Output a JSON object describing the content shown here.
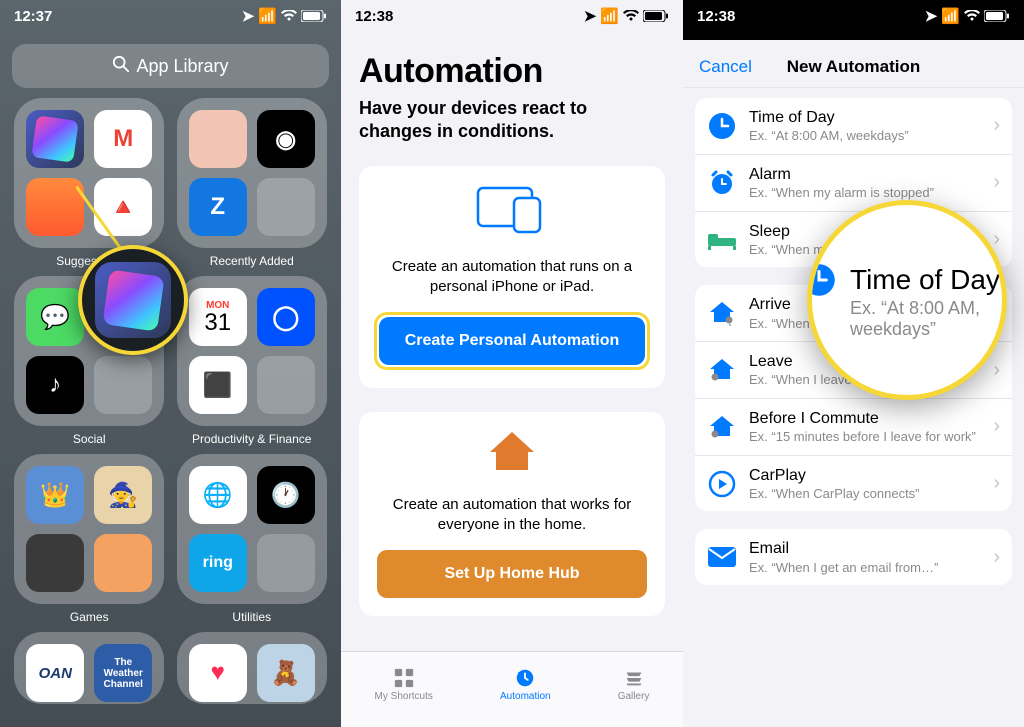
{
  "status": {
    "time_1": "12:37",
    "time_2": "12:38",
    "time_3": "12:38"
  },
  "panel1": {
    "search_label": "App Library",
    "folders": [
      {
        "name": "Suggestions"
      },
      {
        "name": "Recently Added"
      },
      {
        "name": "Social"
      },
      {
        "name": "Productivity & Finance"
      },
      {
        "name": "Games"
      },
      {
        "name": "Utilities"
      }
    ],
    "shortcuts_app_name": "Shortcuts"
  },
  "panel2": {
    "title": "Automation",
    "subtitle": "Have your devices react to changes in conditions.",
    "personal_card_text": "Create an automation that runs on a personal iPhone or iPad.",
    "personal_button": "Create Personal Automation",
    "home_card_text": "Create an automation that works for everyone in the home.",
    "home_button": "Set Up Home Hub",
    "tabs": {
      "shortcuts": "My Shortcuts",
      "automation": "Automation",
      "gallery": "Gallery"
    }
  },
  "panel3": {
    "cancel": "Cancel",
    "nav_title": "New Automation",
    "triggers": [
      {
        "icon": "clock",
        "title": "Time of Day",
        "subtitle": "Ex. “At 8:00 AM, weekdays”"
      },
      {
        "icon": "alarm",
        "title": "Alarm",
        "subtitle": "Ex. “When my alarm is stopped”"
      },
      {
        "icon": "sleep",
        "title": "Sleep",
        "subtitle": "Ex. “When my Wind Down starts”"
      },
      {
        "icon": "arrive",
        "title": "Arrive",
        "subtitle": "Ex. “When I arrive at the gym”"
      },
      {
        "icon": "leave",
        "title": "Leave",
        "subtitle": "Ex. “When I leave work”"
      },
      {
        "icon": "commute",
        "title": "Before I Commute",
        "subtitle": "Ex. “15 minutes before I leave for work”"
      },
      {
        "icon": "carplay",
        "title": "CarPlay",
        "subtitle": "Ex. “When CarPlay connects”"
      },
      {
        "icon": "email",
        "title": "Email",
        "subtitle": "Ex. “When I get an email from…”"
      }
    ],
    "callout": {
      "title": "Time of Day",
      "subtitle": "Ex. “At 8:00 AM, weekdays”"
    }
  },
  "colors": {
    "ios_blue": "#007aff",
    "ios_orange": "#e08a2e",
    "highlight_yellow": "#f6d738",
    "home_orange_icon": "#e07b2e"
  }
}
